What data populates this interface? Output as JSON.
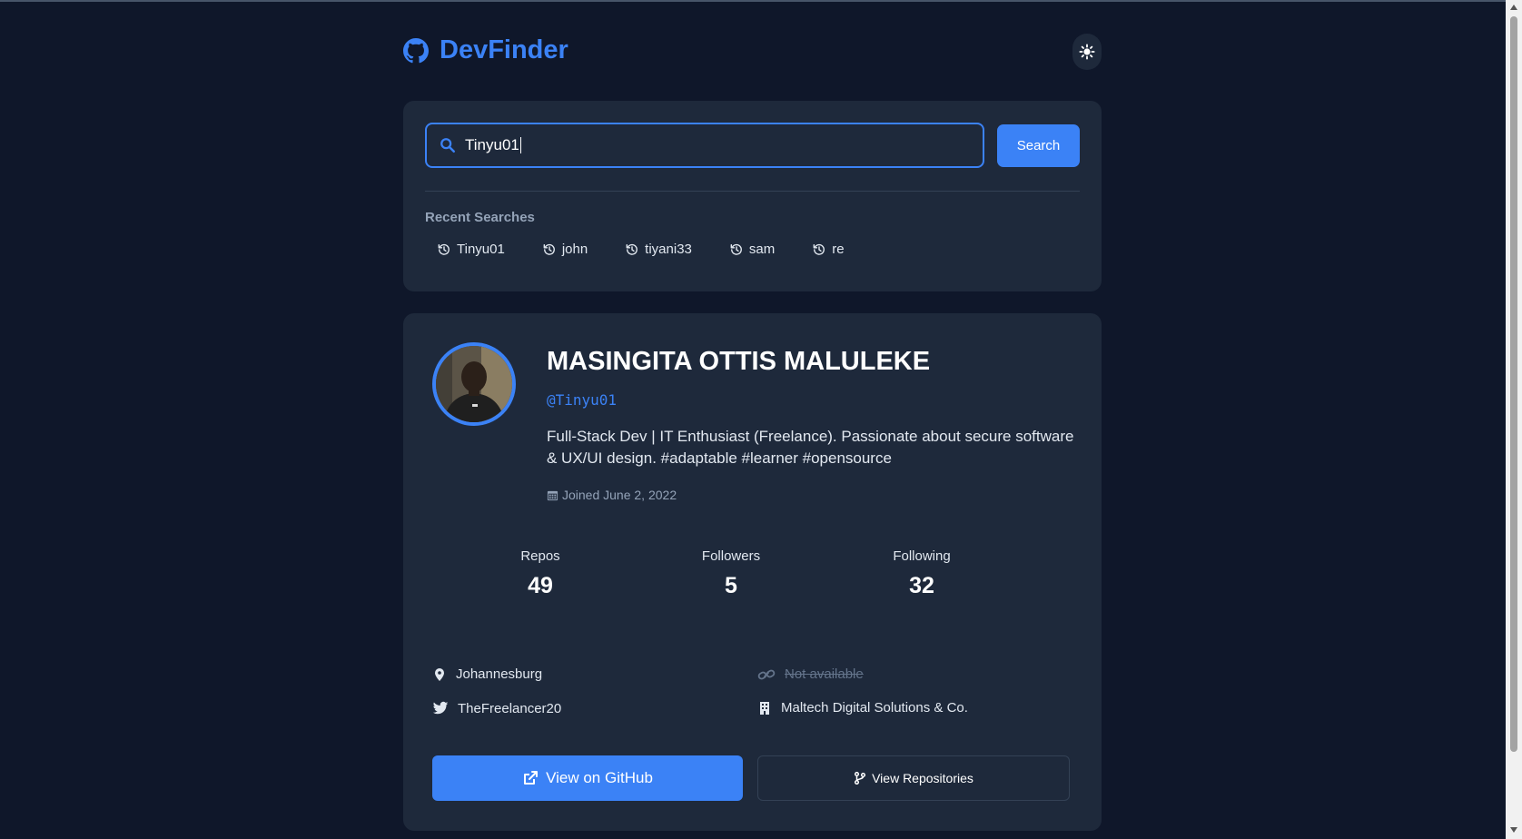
{
  "app": {
    "title": "DevFinder"
  },
  "search": {
    "value": "Tinyu01",
    "button_label": "Search",
    "recent_title": "Recent Searches",
    "recent": [
      "Tinyu01",
      "john",
      "tiyani33",
      "sam",
      "re"
    ]
  },
  "profile": {
    "name": "MASINGITA OTTIS MALULEKE",
    "login": "@Tinyu01",
    "bio": "Full-Stack Dev | IT Enthusiast (Freelance). Passionate about secure software & UX/UI design. #adaptable #learner #opensource",
    "joined": "Joined June 2, 2022",
    "stats": [
      {
        "label": "Repos",
        "value": "49"
      },
      {
        "label": "Followers",
        "value": "5"
      },
      {
        "label": "Following",
        "value": "32"
      }
    ],
    "location": "Johannesburg",
    "blog": "Not available",
    "twitter": "TheFreelancer20",
    "company": "Maltech Digital Solutions & Co."
  },
  "actions": {
    "github_label": "View on GitHub",
    "repos_label": "View Repositories"
  },
  "colors": {
    "background": "#0f172a",
    "card": "#1e293b",
    "accent": "#3b82f6",
    "muted": "#94a3b8"
  },
  "icons": {
    "logo": "github-icon",
    "theme": "sun-icon",
    "search": "search-icon",
    "recent": "history-icon",
    "joined": "calendar-icon",
    "location": "map-pin-icon",
    "blog": "link-icon",
    "twitter": "twitter-icon",
    "company": "building-icon",
    "github_button": "external-link-icon",
    "repos_button": "code-branch-icon"
  }
}
